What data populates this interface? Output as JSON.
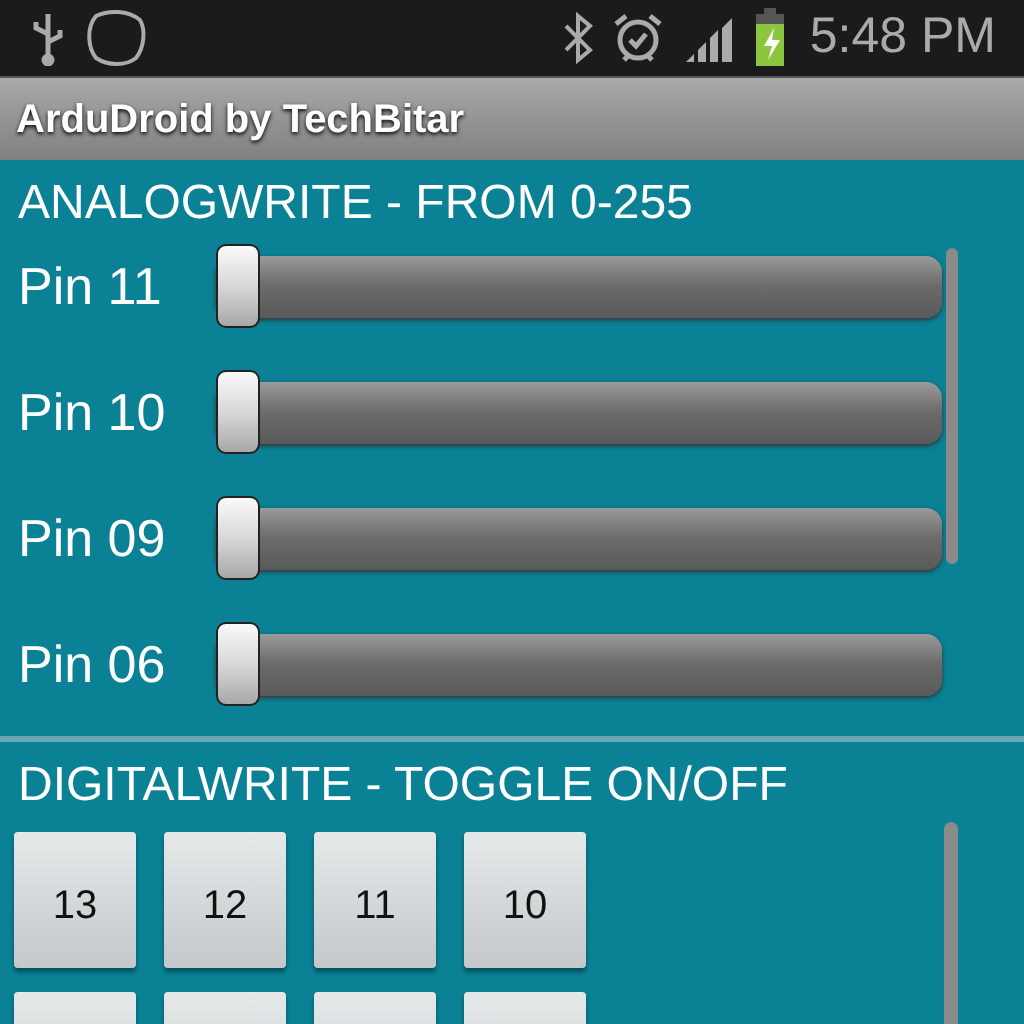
{
  "status_bar": {
    "time": "5:48 PM"
  },
  "app_bar": {
    "title": "ArduDroid by TechBitar"
  },
  "analog_section": {
    "heading": "ANALOGWRITE - FROM 0-255",
    "pins": [
      {
        "label": "Pin 11",
        "level": 0
      },
      {
        "label": "Pin 10",
        "level": 0
      },
      {
        "label": "Pin 09",
        "level": 0
      },
      {
        "label": "Pin 06",
        "level": 0
      }
    ]
  },
  "digital_section": {
    "heading": "DIGITALWRITE - TOGGLE ON/OFF",
    "buttons": [
      {
        "kind": "labeled",
        "label": "13"
      },
      {
        "kind": "labeled",
        "label": "12"
      },
      {
        "kind": "labeled",
        "label": "11"
      },
      {
        "kind": "labeled",
        "label": "10"
      },
      {
        "kind": "cut_off"
      },
      {
        "kind": "cut_off"
      },
      {
        "kind": "cut_off"
      },
      {
        "kind": "cut_off"
      }
    ]
  }
}
